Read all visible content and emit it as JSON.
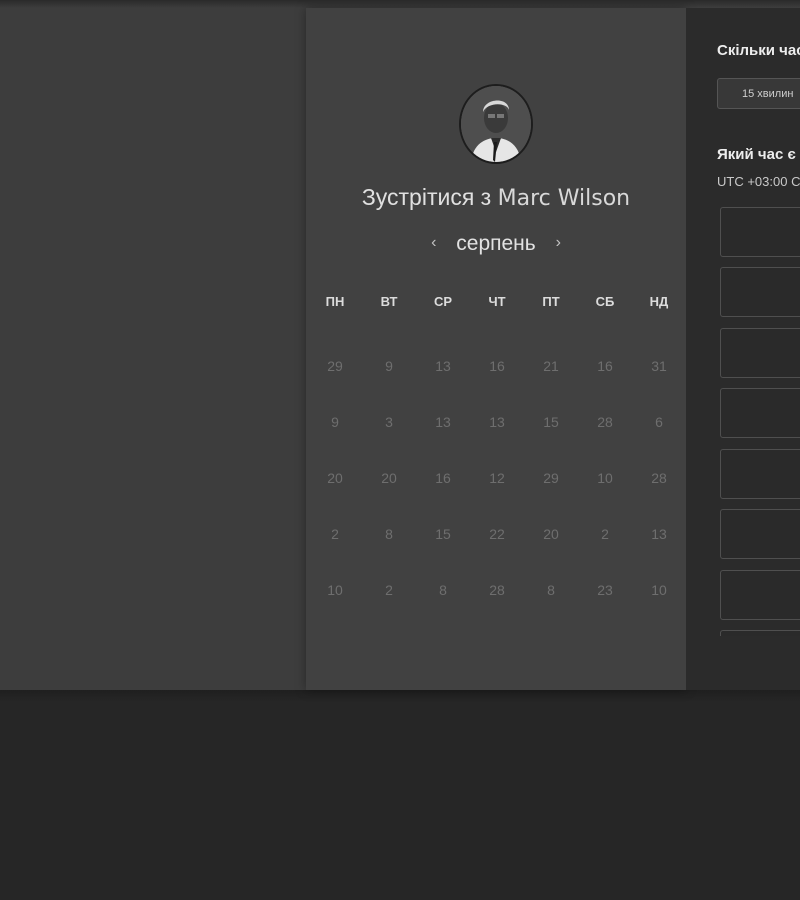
{
  "meeting": {
    "title_prefix": "Зустрітися з",
    "host_name": "Marc Wilson"
  },
  "calendar": {
    "month": "серпень",
    "prev_icon": "‹",
    "next_icon": "›",
    "weekdays": [
      "ПН",
      "ВТ",
      "СР",
      "ЧТ",
      "ПТ",
      "СБ",
      "НД"
    ],
    "weeks": [
      [
        "29",
        "9",
        "13",
        "16",
        "21",
        "16",
        "31"
      ],
      [
        "9",
        "3",
        "13",
        "13",
        "15",
        "28",
        "6"
      ],
      [
        "20",
        "20",
        "16",
        "12",
        "29",
        "10",
        "28"
      ],
      [
        "2",
        "8",
        "15",
        "22",
        "20",
        "2",
        "13"
      ],
      [
        "10",
        "2",
        "8",
        "28",
        "8",
        "23",
        "10"
      ]
    ]
  },
  "panel": {
    "duration_question": "Скільки час",
    "duration_value": "15 хвилин",
    "time_question": "Який час є",
    "timezone": "UTC +03:00 C"
  },
  "colors": {
    "background": "#262626",
    "card": "#414141",
    "panel": "#2b2b2b",
    "day_text": "#6e6e6e"
  }
}
